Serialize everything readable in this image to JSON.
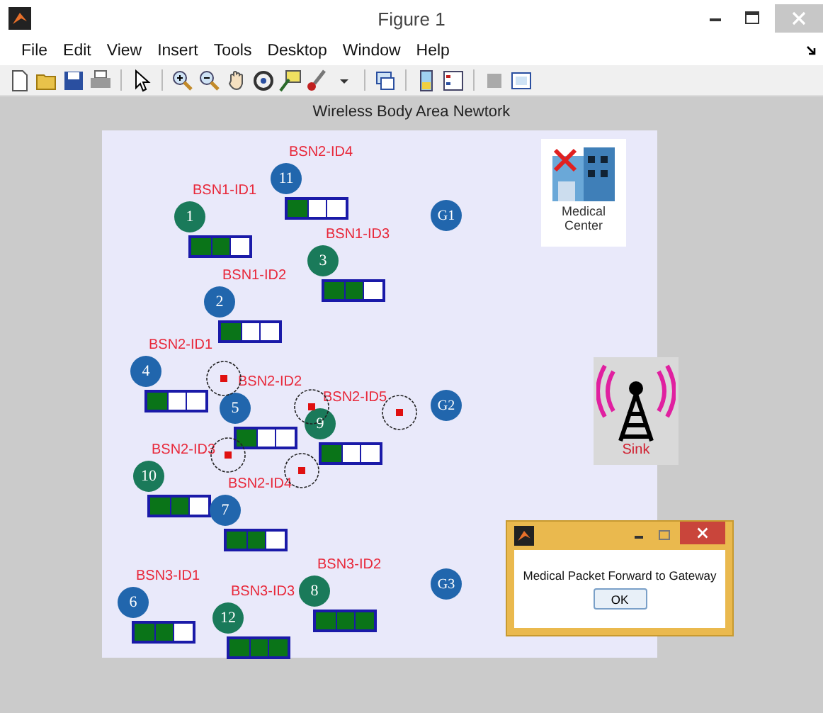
{
  "window": {
    "title": "Figure 1"
  },
  "menu": [
    {
      "label": "File"
    },
    {
      "label": "Edit"
    },
    {
      "label": "View"
    },
    {
      "label": "Insert"
    },
    {
      "label": "Tools"
    },
    {
      "label": "Desktop"
    },
    {
      "label": "Window"
    },
    {
      "label": "Help"
    }
  ],
  "plot": {
    "title": "Wireless Body Area Newtork",
    "nodes": [
      {
        "number": "11",
        "tag": "BSN2-ID4",
        "color": "#2166ad",
        "level": 0.33
      },
      {
        "number": "1",
        "tag": "BSN1-ID1",
        "color": "#1a7a5a",
        "level": 0.67
      },
      {
        "number": "3",
        "tag": "BSN1-ID3",
        "color": "#1a7a5a",
        "level": 0.67
      },
      {
        "number": "2",
        "tag": "BSN1-ID2",
        "color": "#2166ad",
        "level": 0.33
      },
      {
        "number": "4",
        "tag": "BSN2-ID1",
        "color": "#2166ad",
        "level": 0.33
      },
      {
        "number": "5",
        "tag": "BSN2-ID2",
        "color": "#2166ad",
        "level": 0.33
      },
      {
        "number": "9",
        "tag": "BSN2-ID5",
        "color": "#1a7a5a",
        "level": 0.33
      },
      {
        "number": "10",
        "tag": "BSN2-ID3",
        "color": "#1a7a5a",
        "level": 0.67
      },
      {
        "number": "7",
        "tag": "BSN2-ID4",
        "color": "#2166ad",
        "level": 0.67
      },
      {
        "number": "6",
        "tag": "BSN3-ID1",
        "color": "#2166ad",
        "level": 0.67
      },
      {
        "number": "8",
        "tag": "BSN3-ID2",
        "color": "#1a7a5a",
        "level": 1
      },
      {
        "number": "12",
        "tag": "BSN3-ID3",
        "color": "#1a7a5a",
        "level": 1
      }
    ],
    "gateways": [
      {
        "label": "G1"
      },
      {
        "label": "G2"
      },
      {
        "label": "G3"
      }
    ],
    "medical_center": {
      "label": "Medical Center"
    },
    "sink": {
      "label": "Sink"
    }
  },
  "dialog": {
    "message": "Medical Packet Forward to Gateway",
    "button": "OK"
  }
}
